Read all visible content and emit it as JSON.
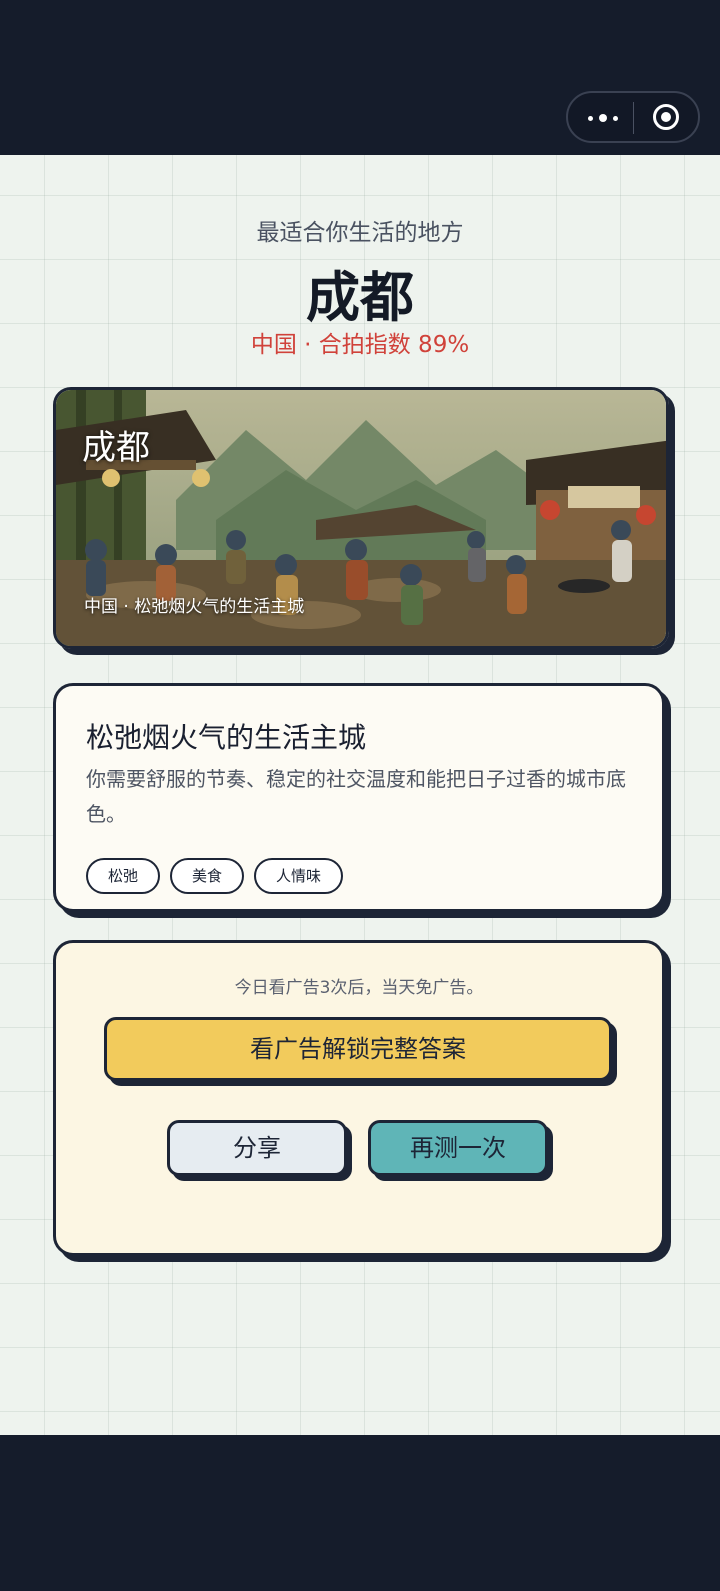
{
  "header": {
    "capsule": {
      "more_icon": "more-dots-icon",
      "close_icon": "target-circle-icon"
    }
  },
  "result": {
    "subtitle": "最适合你生活的地方",
    "city": "成都",
    "score_line": "中国 · 合拍指数 89%"
  },
  "photo": {
    "title": "成都",
    "caption": "中国 · 松弛烟火气的生活主城"
  },
  "description": {
    "title": "松弛烟火气的生活主城",
    "text": "你需要舒服的节奏、稳定的社交温度和能把日子过香的城市底色。",
    "tags": [
      "松弛",
      "美食",
      "人情味"
    ]
  },
  "actions": {
    "ad_note": "今日看广告3次后，当天免广告。",
    "unlock_label": "看广告解锁完整答案",
    "share_label": "分享",
    "retry_label": "再测一次"
  },
  "colors": {
    "accent_score": "#d0423a",
    "unlock_button": "#f2cb5c",
    "retry_button": "#5fb5b7",
    "share_button": "#e6ecf1",
    "frame": "#151c2b"
  }
}
